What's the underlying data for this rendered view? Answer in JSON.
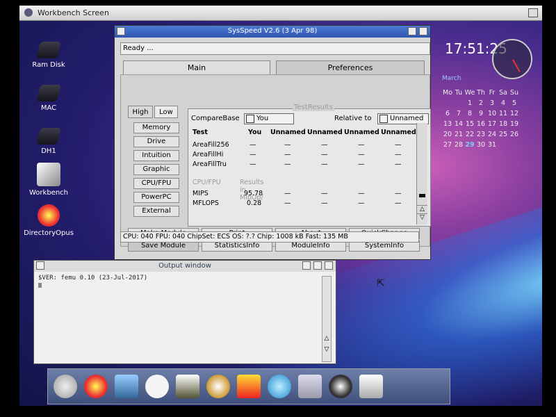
{
  "screen": {
    "title": "Workbench Screen"
  },
  "desktop_icons": [
    {
      "label": "Ram Disk"
    },
    {
      "label": "MAC"
    },
    {
      "label": "DH1"
    },
    {
      "label": "Workbench"
    },
    {
      "label": "DirectoryOpus"
    }
  ],
  "sysspeed": {
    "title": "SysSpeed  V2.6 (3 Apr 98)",
    "status": "Ready ...",
    "tabs": [
      "Main",
      "Preferences"
    ],
    "subtabs": [
      "High",
      "Low"
    ],
    "side_buttons": [
      "Memory",
      "Drive",
      "Intuition",
      "Graphic",
      "CPU/FPU",
      "PowerPC",
      "External"
    ],
    "results": {
      "legend": "TestResults",
      "compare_label": "CompareBase",
      "compare_value": "You",
      "relative_label": "Relative to",
      "relative_value": "Unnamed",
      "headers": [
        "Test",
        "You",
        "Unnamed",
        "Unnamed",
        "Unnamed",
        "Unnamed"
      ],
      "rows1": [
        {
          "test": "AreaFill256",
          "you": "—",
          "u1": "—",
          "u2": "—",
          "u3": "—",
          "u4": "—"
        },
        {
          "test": "AreaFillHi",
          "you": "—",
          "u1": "—",
          "u2": "—",
          "u3": "—",
          "u4": "—"
        },
        {
          "test": "AreaFillTru",
          "you": "—",
          "u1": "—",
          "u2": "—",
          "u3": "—",
          "u4": "—"
        }
      ],
      "section2": {
        "a": "CPU/FPU",
        "b": "Results  in MipOp/"
      },
      "rows2": [
        {
          "test": "MIPS",
          "you": "95.78",
          "u1": "—",
          "u2": "—",
          "u3": "—",
          "u4": "—"
        },
        {
          "test": "MFLOPS",
          "you": "0.28",
          "u1": "—",
          "u2": "—",
          "u3": "—",
          "u4": "—"
        }
      ]
    },
    "bottom_buttons": [
      "Make Module",
      "Print",
      "About",
      "QuickChange",
      "Save Module",
      "StatisticsInfo",
      "ModuleInfo",
      "SystemInfo"
    ],
    "info": "CPU: 040  FPU: 040  ChipSet: ECS  OS: ?.?  Chip: 1008 kB  Fast: 135 MB"
  },
  "output": {
    "title": "Output window",
    "text": "$VER: femu 0.10 (23-Jul-2017)"
  },
  "clock": {
    "time": "17:51:25",
    "month": "March",
    "weekdays": [
      "Mo",
      "Tu",
      "We",
      "Th",
      "Fr",
      "Sa",
      "Su"
    ],
    "weeks": [
      [
        "",
        "",
        "1",
        "2",
        "3",
        "4",
        "5"
      ],
      [
        "6",
        "7",
        "8",
        "9",
        "10",
        "11",
        "12"
      ],
      [
        "13",
        "14",
        "15",
        "16",
        "17",
        "18",
        "19"
      ],
      [
        "20",
        "21",
        "22",
        "23",
        "24",
        "25",
        "26"
      ],
      [
        "27",
        "28",
        "29",
        "30",
        "31",
        "",
        ""
      ]
    ],
    "today": "29"
  }
}
